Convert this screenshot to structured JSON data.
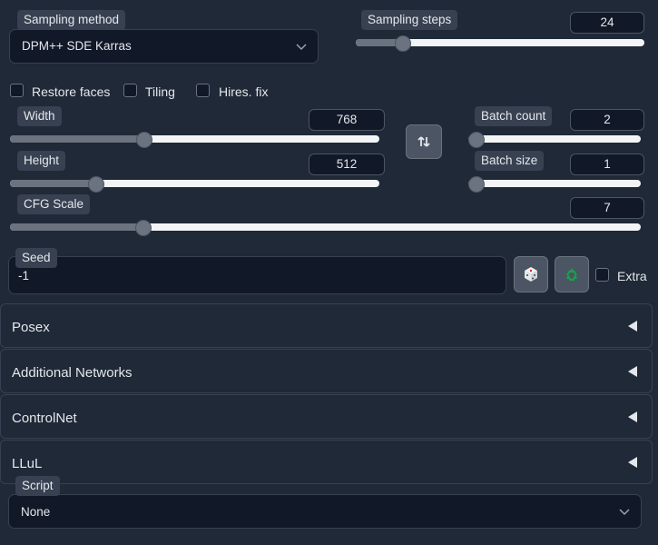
{
  "sampling_method": {
    "label": "Sampling method",
    "value": "DPM++ SDE Karras"
  },
  "sampling_steps": {
    "label": "Sampling steps",
    "value": "24",
    "fraction": 0.16
  },
  "options": {
    "restore_faces": "Restore faces",
    "tiling": "Tiling",
    "hires_fix": "Hires. fix"
  },
  "width": {
    "label": "Width",
    "value": "768",
    "fraction": 0.36
  },
  "height": {
    "label": "Height",
    "value": "512",
    "fraction": 0.23
  },
  "batch_count": {
    "label": "Batch count",
    "value": "2",
    "fraction": 0.0
  },
  "batch_size": {
    "label": "Batch size",
    "value": "1",
    "fraction": 0.0
  },
  "cfg_scale": {
    "label": "CFG Scale",
    "value": "7",
    "fraction": 0.21
  },
  "seed": {
    "label": "Seed",
    "value": "-1",
    "extra_label": "Extra"
  },
  "sections": [
    "Posex",
    "Additional Networks",
    "ControlNet",
    "LLuL"
  ],
  "script": {
    "label": "Script",
    "value": "None"
  },
  "colors": {
    "background": "#1f2937",
    "input_bg": "#111827",
    "slider_fill": "#6b7280",
    "accent_recycle": "#16a34a"
  },
  "icons": [
    "chevron-down-icon",
    "swap-icon",
    "dice-icon",
    "recycle-icon",
    "collapse-triangle-icon"
  ]
}
